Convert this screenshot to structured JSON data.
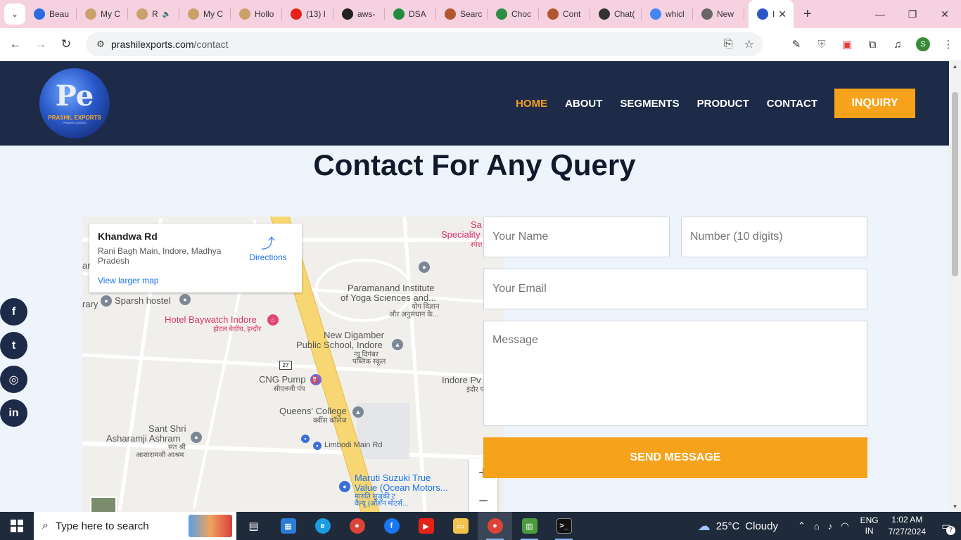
{
  "browser": {
    "tabs": [
      {
        "title": "Beau",
        "favicon": "blue-circle",
        "color": "#2a6cdf"
      },
      {
        "title": "My C",
        "favicon": "mascot",
        "color": "#c9a26b"
      },
      {
        "title": "R",
        "favicon": "mascot",
        "color": "#c9a26b",
        "audio": "speaker-icon"
      },
      {
        "title": "My C",
        "favicon": "mascot",
        "color": "#c9a26b"
      },
      {
        "title": "Hollo",
        "favicon": "mascot",
        "color": "#c9a26b"
      },
      {
        "title": "(13) I",
        "favicon": "youtube",
        "color": "#e62117"
      },
      {
        "title": "aws-",
        "favicon": "github",
        "color": "#222222"
      },
      {
        "title": "DSA",
        "favicon": "sheets",
        "color": "#1e8e3e"
      },
      {
        "title": "Searc",
        "favicon": "claude",
        "color": "#b0572f"
      },
      {
        "title": "Choc",
        "favicon": "gfg",
        "color": "#2f8d46"
      },
      {
        "title": "Cont",
        "favicon": "claude",
        "color": "#b0572f"
      },
      {
        "title": "Chat(",
        "favicon": "openai",
        "color": "#333333"
      },
      {
        "title": "whicl",
        "favicon": "google",
        "color": "#4285f4"
      },
      {
        "title": "New",
        "favicon": "chrome",
        "color": "#666666"
      }
    ],
    "active_tab": {
      "title": "I",
      "favicon": "prashil-logo"
    },
    "url_host": "prashilexports.com",
    "url_path": "/contact",
    "profile_initial": "S"
  },
  "site": {
    "logo": {
      "monogram": "Pe",
      "name": "PRASHIL EXPORTS",
      "subname": "PRIVATE LIMITED"
    },
    "nav": [
      "HOME",
      "ABOUT",
      "SEGMENTS",
      "PRODUCT",
      "CONTACT"
    ],
    "nav_active": "HOME",
    "inquiry_label": "INQUIRY",
    "accent_color": "#f7a21b",
    "header_color": "#1d2a48",
    "page_title": "Contact For Any Query"
  },
  "map": {
    "card_title": "Khandwa Rd",
    "card_address": "Rani Bagh Main, Indore, Madhya Pradesh",
    "card_link": "View larger map",
    "directions_label": "Directions",
    "places": {
      "sparsh": "Sparsh hostel",
      "hotel": "Hotel Baywatch Indore",
      "hotel_hi": "होटल बेवॉच, इन्दौर",
      "yoga1": "Paramanand Institute",
      "yoga2": "of Yoga Sciences and...",
      "yoga_hi1": "योग विज्ञान",
      "yoga_hi2": "और अनुसंधान के...",
      "digamber1": "New Digamber",
      "digamber2": "Public School, Indore",
      "digamber_hi1": "न्यू दिगंबर",
      "digamber_hi2": "पब्लिक स्कूल",
      "cng": "CNG Pump",
      "cng_hi": "सीएनजी पंप",
      "queens": "Queens' College",
      "queens_hi": "क्वींस कॉलेज",
      "indore_pv": "Indore Pv",
      "indore_pv_hi": "इंदौर पं",
      "ashram1": "Sant Shri",
      "ashram2": "Asharamji Ashram",
      "ashram_hi1": "संत श्री",
      "ashram_hi2": "आशारामजी आश्रम",
      "limbodi": "Limbodi Main Rd",
      "maruti1": "Maruti Suzuki True",
      "maruti2": "Value (Ocean Motors...",
      "maruti_hi1": "मारुति सुजुकी ट",
      "maruti_hi2": "वैल्यू (ओशन मोटर्स...",
      "sa1": "Sa",
      "sa2": "Speciality",
      "sa_hi": "स्पेश",
      "ar": "ar",
      "rary": "rary",
      "highway": "27"
    }
  },
  "form": {
    "name_placeholder": "Your Name",
    "number_placeholder": "Number (10 digits)",
    "email_placeholder": "Your Email",
    "message_placeholder": "Message",
    "send_label": "SEND MESSAGE"
  },
  "social": [
    "facebook-icon",
    "twitter-icon",
    "instagram-icon",
    "linkedin-icon"
  ],
  "taskbar": {
    "search_placeholder": "Type here to search",
    "weather_temp": "25°C",
    "weather_desc": "Cloudy",
    "lang1": "ENG",
    "lang2": "IN",
    "time": "1:02 AM",
    "date": "7/27/2024",
    "notifications": "7"
  }
}
